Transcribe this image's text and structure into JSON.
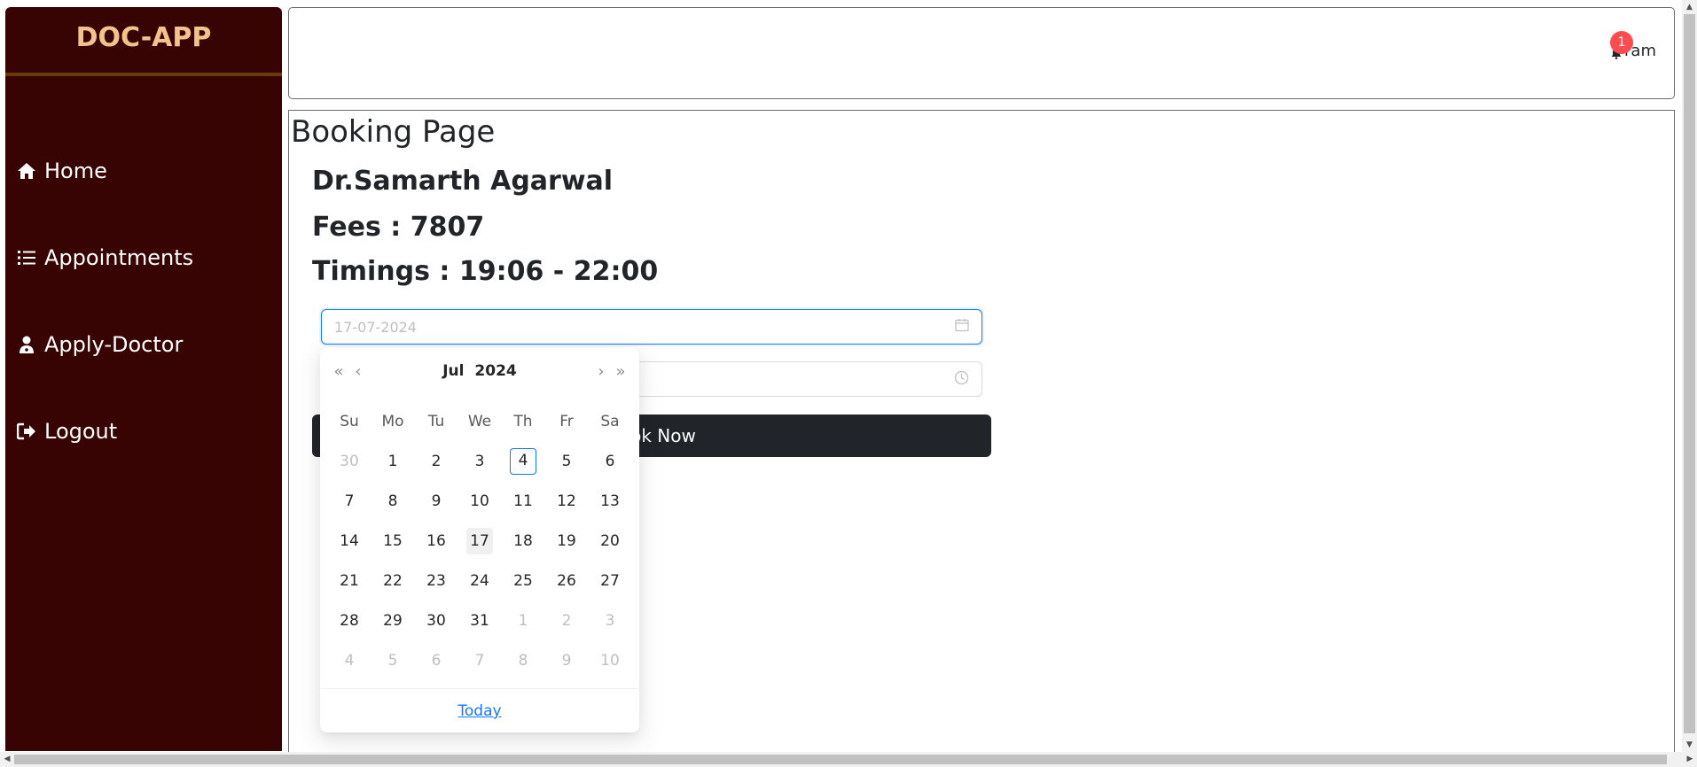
{
  "brand": "DOC-APP",
  "sidebar": {
    "items": [
      {
        "label": "Home",
        "icon": "home-icon"
      },
      {
        "label": "Appointments",
        "icon": "list-icon"
      },
      {
        "label": "Apply-Doctor",
        "icon": "user-doctor-icon"
      },
      {
        "label": "Logout",
        "icon": "logout-icon"
      }
    ]
  },
  "header": {
    "notification_count": "1",
    "user_name": "ram"
  },
  "main": {
    "title": "Booking Page",
    "doctor_name": "Dr.Samarth Agarwal",
    "fees": "Fees : 7807",
    "timings": "Timings : 19:06 - 22:00",
    "date_value": "17-07-2024",
    "book_label": "Book Now"
  },
  "calendar": {
    "month": "Jul",
    "year": "2024",
    "weekdays": [
      "Su",
      "Mo",
      "Tu",
      "We",
      "Th",
      "Fr",
      "Sa"
    ],
    "weeks": [
      [
        "30",
        "1",
        "2",
        "3",
        "4",
        "5",
        "6"
      ],
      [
        "7",
        "8",
        "9",
        "10",
        "11",
        "12",
        "13"
      ],
      [
        "14",
        "15",
        "16",
        "17",
        "18",
        "19",
        "20"
      ],
      [
        "21",
        "22",
        "23",
        "24",
        "25",
        "26",
        "27"
      ],
      [
        "28",
        "29",
        "30",
        "31",
        "1",
        "2",
        "3"
      ],
      [
        "4",
        "5",
        "6",
        "7",
        "8",
        "9",
        "10"
      ]
    ],
    "today_day": "4",
    "selected_day": "17",
    "footer_link": "Today"
  },
  "colors": {
    "sidebar_bg": "#370303",
    "brand_text": "#f3c38b",
    "accent": "#1677ff",
    "badge": "#ff4d4f",
    "button_bg": "#212529"
  }
}
